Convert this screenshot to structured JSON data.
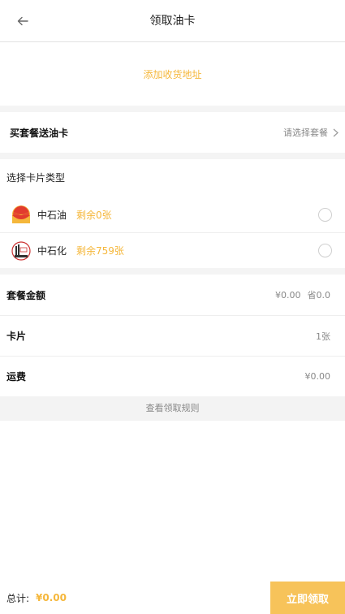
{
  "header": {
    "title": "领取油卡",
    "back_icon": "arrow-left-icon"
  },
  "address": {
    "add_label": "添加收货地址"
  },
  "package": {
    "title": "买套餐送油卡",
    "placeholder": "请选择套餐",
    "chevron_icon": "chevron-right-icon"
  },
  "card_types": {
    "title": "选择卡片类型",
    "items": [
      {
        "brand": "中石油",
        "remaining": "剩余0张",
        "logo_icon": "petrochina-logo-icon"
      },
      {
        "brand": "中石化",
        "remaining": "剩余759张",
        "logo_icon": "sinopec-logo-icon"
      }
    ]
  },
  "summary": {
    "amount_label": "套餐金额",
    "amount_value": "¥0.00",
    "amount_saved": "省0.0",
    "card_label": "卡片",
    "card_value": "1张",
    "shipping_label": "运费",
    "shipping_value": "¥0.00"
  },
  "rules_link": "查看领取规则",
  "footer": {
    "total_label": "总计:",
    "total_value": "¥0.00",
    "claim_button": "立即领取"
  },
  "colors": {
    "accent": "#f5b73b",
    "button_bg": "#f7c35a",
    "divider": "#f4f4f4"
  }
}
